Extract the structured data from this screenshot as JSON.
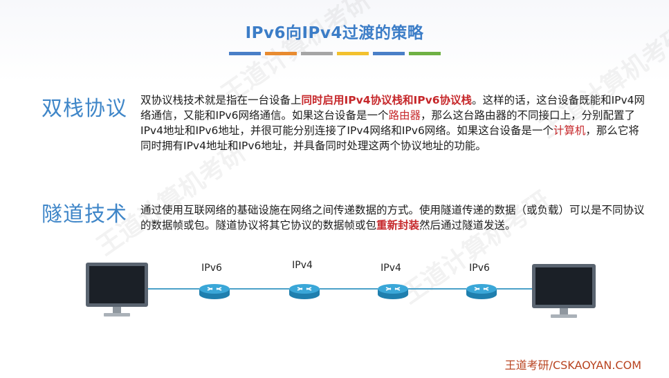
{
  "slide": {
    "title": "IPv6向IPv4过渡的策略",
    "color_bars": [
      "#4a7fc7",
      "#e88b30",
      "#a5a5a5",
      "#f2c12e",
      "#4a7fc7",
      "#6fb144"
    ]
  },
  "dual_stack": {
    "heading": "双栈协议",
    "p1": "双协议栈技术就是指在一台设备上",
    "h1": "同时启用IPv4协议栈和IPv6协议栈",
    "p2": "。这样的话，这台设备既能和IPv4网络通信，又能和IPv6网络通信。如果这台设备是一个",
    "h2": "路由器",
    "p3": "，那么这台路由器的不同接口上，分别配置了IPv4地址和IPv6地址，并很可能分别连接了IPv4网络和IPv6网络。如果这台设备是一个",
    "h3": "计算机",
    "p4": "，那么它将同时拥有IPv4地址和IPv6地址，并具备同时处理这两个协议地址的功能。"
  },
  "tunnel": {
    "heading": "隧道技术",
    "p1": "通过使用互联网络的基础设施在网络之间传递数据的方式。使用隧道传递的数据（或负载）可以是不同协议的数据帧或包。隧道协议将其它协议的数据帧或包",
    "h1": "重新封装",
    "p2": "然后通过隧道发送。"
  },
  "diagram": {
    "labels": [
      "IPv6",
      "IPv4",
      "IPv4",
      "IPv6"
    ]
  },
  "footer": "王道考研/CSKAOYAN.COM",
  "watermark": "王道计算机考研"
}
